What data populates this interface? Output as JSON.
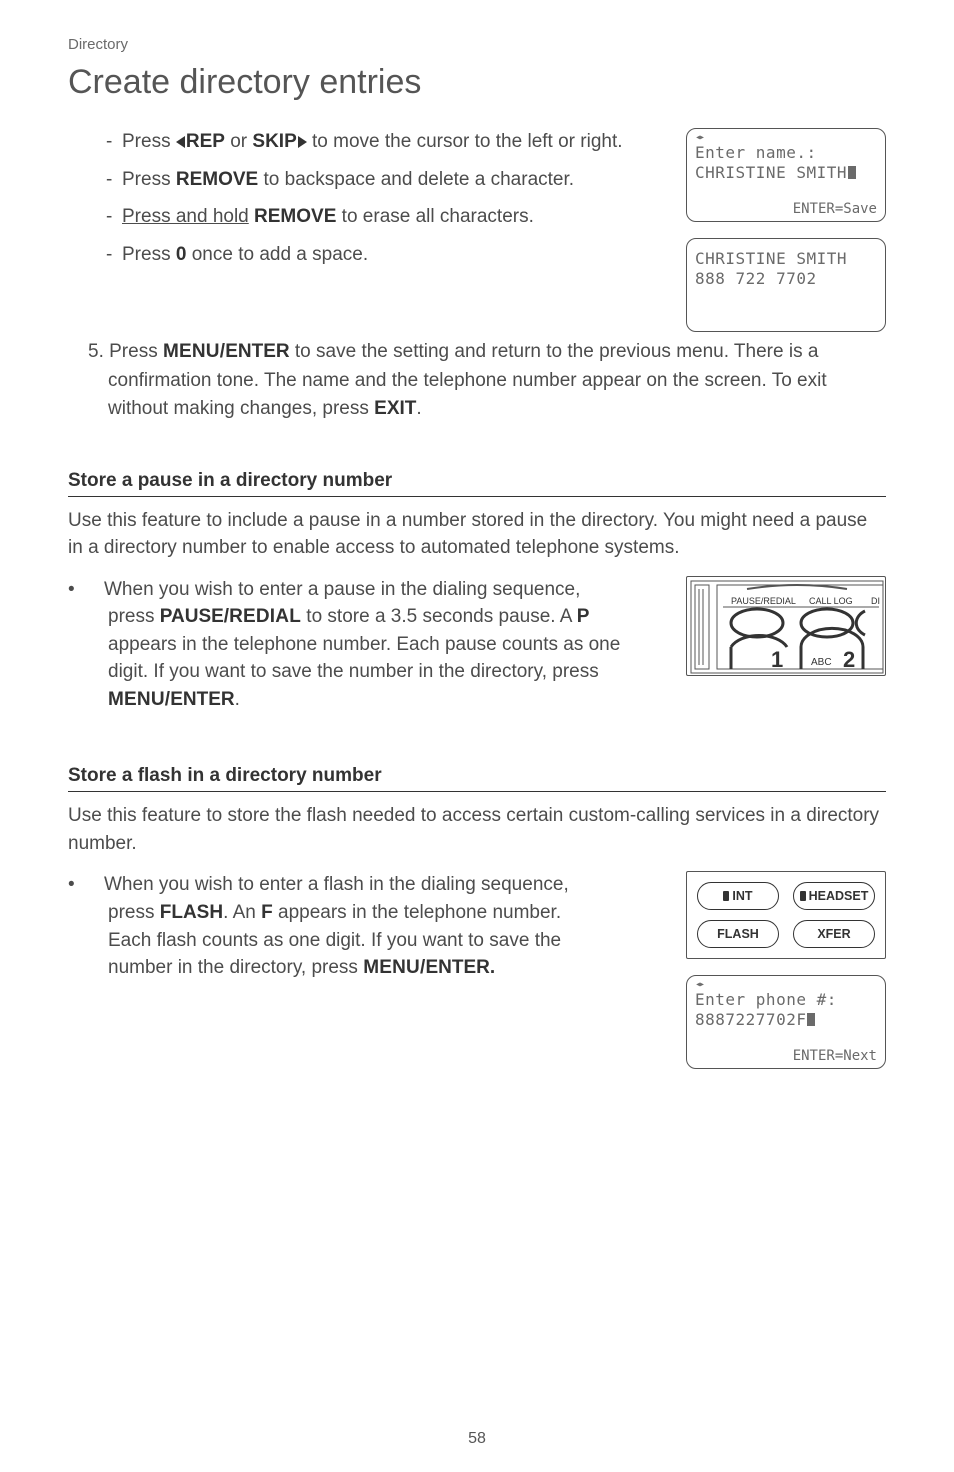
{
  "header": {
    "section": "Directory",
    "title": "Create directory entries"
  },
  "steps": {
    "items": [
      {
        "pre": "Press ",
        "k1": "REP",
        "mid": " or ",
        "k2": "SKIP",
        "post": " to move the cursor to the left or right."
      },
      {
        "pre": "Press ",
        "k1": "REMOVE",
        "post": " to backspace and delete a character."
      },
      {
        "pre_u": "Press and hold",
        "k1": "REMOVE",
        "post": " to erase all characters."
      },
      {
        "pre": "Press ",
        "k1": "0",
        "post": " once to add a space."
      }
    ],
    "step5_a": "5. Press ",
    "step5_k1": "MENU/",
    "step5_k1b": "ENTER",
    "step5_b": " to save the setting and return to the previous menu. There is a confirmation tone. The name and the telephone number appear on the screen. To exit without making changes, press ",
    "step5_k2": "EXIT",
    "step5_c": "."
  },
  "lcd1": {
    "l1": "Enter name.:",
    "l2": "CHRISTINE SMITH",
    "hint": "ENTER=Save"
  },
  "lcd2": {
    "l1": "CHRISTINE SMITH",
    "l2": "888 722 7702"
  },
  "pauseSection": {
    "heading": "Store a pause in a directory number",
    "p": "Use this feature to include a pause in a number stored in the directory. You might need a pause in a directory number to enable access to automated telephone systems.",
    "b_a": "When you wish to enter a pause in the dialing sequence, press ",
    "b_k1": "PAUSE/",
    "b_k1b": "REDIAL",
    "b_b": " to store a 3.5 seconds pause. A ",
    "b_k2": "P",
    "b_c": " appears in the telephone number. Each pause counts as one digit. If you want to save the number in the directory, press ",
    "b_k3": "MENU/",
    "b_k3b": "ENTER",
    "b_d": "."
  },
  "snipLabels": {
    "a": "PAUSE/REDIAL",
    "b": "CALL LOG",
    "c": "DI",
    "one": "1",
    "abc": "ABC",
    "two": "2"
  },
  "flashSection": {
    "heading": "Store a flash in a directory number",
    "p": "Use this feature to store the flash needed to access certain custom-calling services in a directory number.",
    "b_a": "When you wish to enter a flash in the dialing sequence, press ",
    "b_k1": "FLASH",
    "b_b": ". An ",
    "b_k2": "F",
    "b_c": " appears in the telephone number. Each flash counts as one digit. If you want to save the number in the directory, press ",
    "b_k3": "MENU/",
    "b_k3b": "ENTER."
  },
  "btns": {
    "int": "INT",
    "headset": "HEADSET",
    "flash": "FLASH",
    "xfer": "XFER"
  },
  "lcd3": {
    "l1": "Enter phone #:",
    "l2": "8887227702F",
    "hint": "ENTER=Next"
  },
  "pageNum": "58"
}
